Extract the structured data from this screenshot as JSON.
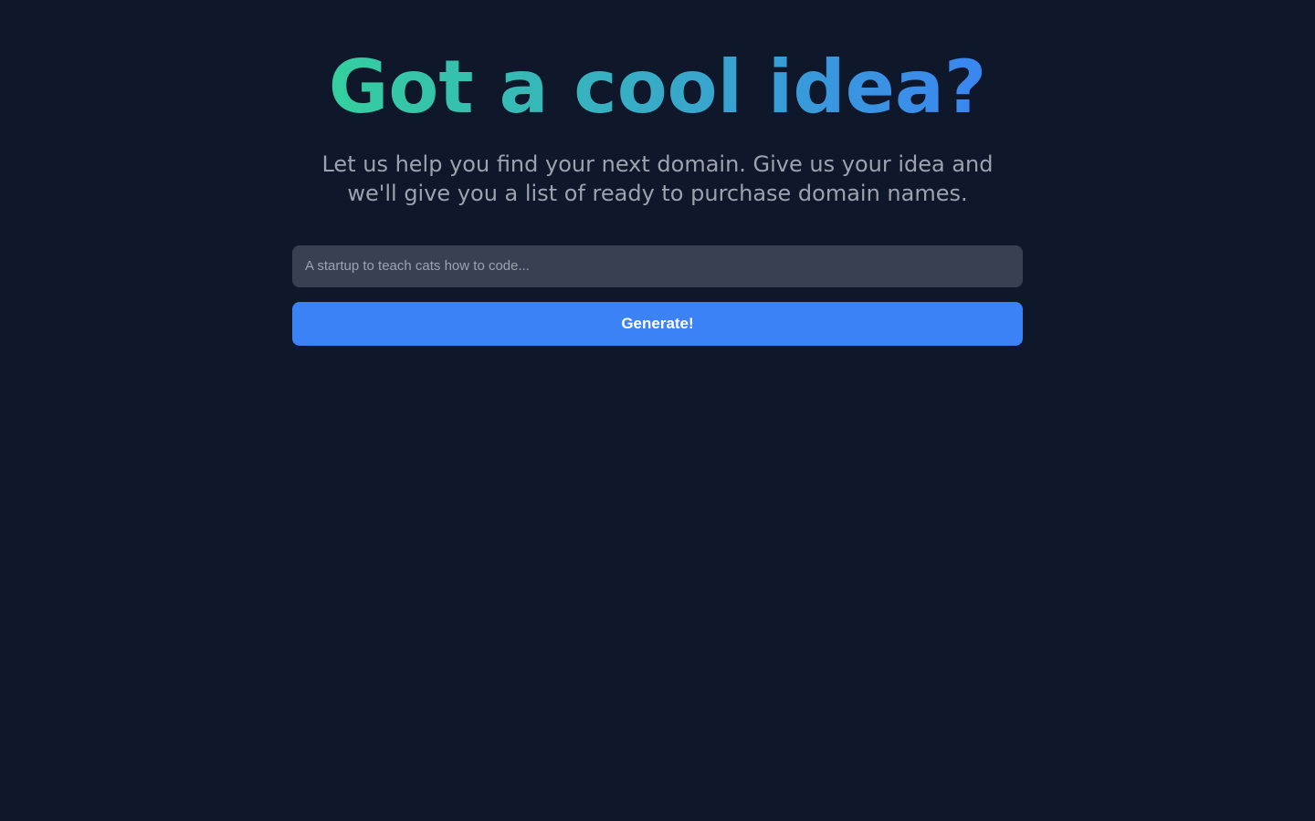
{
  "hero": {
    "headline": "Got a cool idea?",
    "subheadline": "Let us help you find your next domain. Give us your idea and we'll give you a list of ready to purchase domain names."
  },
  "form": {
    "idea_input": {
      "value": "",
      "placeholder": "A startup to teach cats how to code..."
    },
    "generate_button_label": "Generate!"
  },
  "colors": {
    "background": "#0f172a",
    "gradient_from": "#34d399",
    "gradient_to": "#3b82f6",
    "text_muted": "#9ca3af",
    "input_bg": "#374151",
    "button_bg": "#3b82f6"
  }
}
